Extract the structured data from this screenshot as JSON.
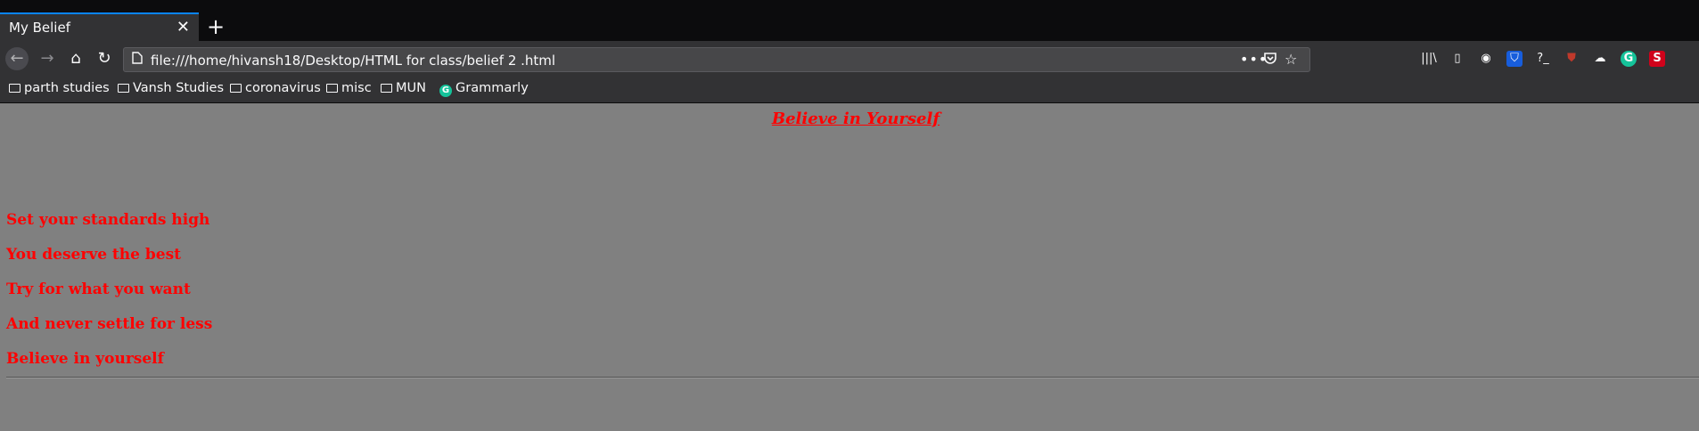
{
  "window": {
    "title": "My Belief"
  },
  "tabs": [
    {
      "label": "My Belief",
      "close_glyph": "✕"
    }
  ],
  "new_tab_glyph": "+",
  "nav": {
    "back_icon": "←",
    "forward_icon": "→",
    "home_icon": "⌂",
    "reload_icon": "↻",
    "url": "file:///home/hivansh18/Desktop/HTML for class/belief 2 .html",
    "more_glyph": "•••",
    "pocket_glyph": "◡",
    "star_glyph": "☆"
  },
  "toolbar_icons": [
    "library-icon",
    "sidebar-icon",
    "account-icon",
    "bitwarden-icon",
    "terminal-icon",
    "ublock-icon",
    "extension-icon",
    "grammarly-icon",
    "extension-s-icon"
  ],
  "toolbar_glyphs": {
    "library": "|||\\",
    "sidebar": "▯",
    "account": "◉",
    "bitwarden": "⛉",
    "terminal": "?_",
    "ublock": "⛊",
    "ext": "☁",
    "grammarly": "G",
    "s": "S"
  },
  "bookmarks": [
    {
      "label": "parth studies"
    },
    {
      "label": "Vansh Studies"
    },
    {
      "label": "coronavirus"
    },
    {
      "label": "misc"
    },
    {
      "label": "MUN"
    },
    {
      "label": "Grammarly"
    }
  ],
  "page": {
    "heading": "Believe in Yourself",
    "lines": [
      "Set your standards high",
      "You deserve the best",
      "Try for what you want",
      "And never settle for less",
      "Believe in yourself"
    ]
  },
  "colors": {
    "page_bg": "#808080",
    "text": "#ff0000",
    "chrome": "#323234",
    "accent": "#0a84ff"
  }
}
